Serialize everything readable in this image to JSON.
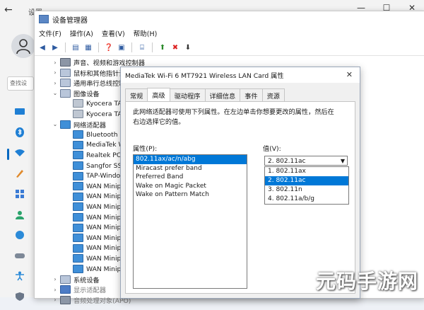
{
  "settings": {
    "title": "设置",
    "find_placeholder": "查找设",
    "window_controls": [
      "—",
      "☐",
      "✕"
    ]
  },
  "device_manager": {
    "title": "设备管理器",
    "menu": [
      "文件(F)",
      "操作(A)",
      "查看(V)",
      "帮助(H)"
    ],
    "tree": [
      {
        "label": "声音、视频和游戏控制器",
        "level": 0,
        "expander": "›",
        "icon": "audio"
      },
      {
        "label": "鼠标和其他指针设备",
        "level": 0,
        "expander": "›",
        "icon": "sys"
      },
      {
        "label": "通用串行总线控制器",
        "level": 0,
        "expander": "›",
        "icon": "sys"
      },
      {
        "label": "图像设备",
        "level": 0,
        "expander": "⌄",
        "icon": "sys"
      },
      {
        "label": "Kyocera TASKa",
        "level": 1,
        "expander": "",
        "icon": "printer"
      },
      {
        "label": "Kyocera TASKa",
        "level": 1,
        "expander": "",
        "icon": "printer"
      },
      {
        "label": "网络适配器",
        "level": 0,
        "expander": "⌄",
        "icon": "net"
      },
      {
        "label": "Bluetooth Devi",
        "level": 1,
        "expander": "",
        "icon": "net"
      },
      {
        "label": "MediaTek Wi-Fi",
        "level": 1,
        "expander": "",
        "icon": "net"
      },
      {
        "label": "Realtek PCIe G",
        "level": 1,
        "expander": "",
        "icon": "net"
      },
      {
        "label": "Sangfor SSL VI",
        "level": 1,
        "expander": "",
        "icon": "net"
      },
      {
        "label": "TAP-Windows A",
        "level": 1,
        "expander": "",
        "icon": "net"
      },
      {
        "label": "WAN Miniport",
        "level": 1,
        "expander": "",
        "icon": "net"
      },
      {
        "label": "WAN Miniport",
        "level": 1,
        "expander": "",
        "icon": "net"
      },
      {
        "label": "WAN Miniport",
        "level": 1,
        "expander": "",
        "icon": "net"
      },
      {
        "label": "WAN Miniport",
        "level": 1,
        "expander": "",
        "icon": "net"
      },
      {
        "label": "WAN Miniport",
        "level": 1,
        "expander": "",
        "icon": "net"
      },
      {
        "label": "WAN Miniport",
        "level": 1,
        "expander": "",
        "icon": "net"
      },
      {
        "label": "WAN Miniport",
        "level": 1,
        "expander": "",
        "icon": "net"
      },
      {
        "label": "WAN Miniport",
        "level": 1,
        "expander": "",
        "icon": "net"
      },
      {
        "label": "WAN Miniport",
        "level": 1,
        "expander": "",
        "icon": "net"
      },
      {
        "label": "系统设备",
        "level": 0,
        "expander": "›",
        "icon": "sys"
      },
      {
        "label": "显示适配器",
        "level": 0,
        "expander": "›",
        "icon": "monitor"
      },
      {
        "label": "音频处理对象(APO)",
        "level": 0,
        "expander": "›",
        "icon": "audio"
      }
    ]
  },
  "dialog": {
    "title": "MediaTek Wi-Fi 6 MT7921 Wireless LAN Card 属性",
    "close": "✕",
    "tabs": [
      "常规",
      "高级",
      "驱动程序",
      "详细信息",
      "事件",
      "资源"
    ],
    "active_tab": "高级",
    "description": "此网络适配器可使用下列属性。在左边单击你想要更改的属性，然后在右边选择它的值。",
    "property_label": "属性(P):",
    "value_label": "值(V):",
    "properties": [
      "802.11ax/ac/n/abg",
      "Miracast prefer band",
      "Preferred Band",
      "Wake on Magic Packet",
      "Wake on Pattern Match"
    ],
    "selected_property": "802.11ax/ac/n/abg",
    "current_value": "2. 802.11ac",
    "value_options": [
      "1. 802.11ax",
      "2. 802.11ac",
      "3. 802.11n",
      "4. 802.11a/b/g"
    ],
    "selected_value": "2. 802.11ac"
  },
  "watermark": "元码手游网",
  "colors": {
    "accent": "#0078d7",
    "settings_accent": "#0067c0"
  }
}
